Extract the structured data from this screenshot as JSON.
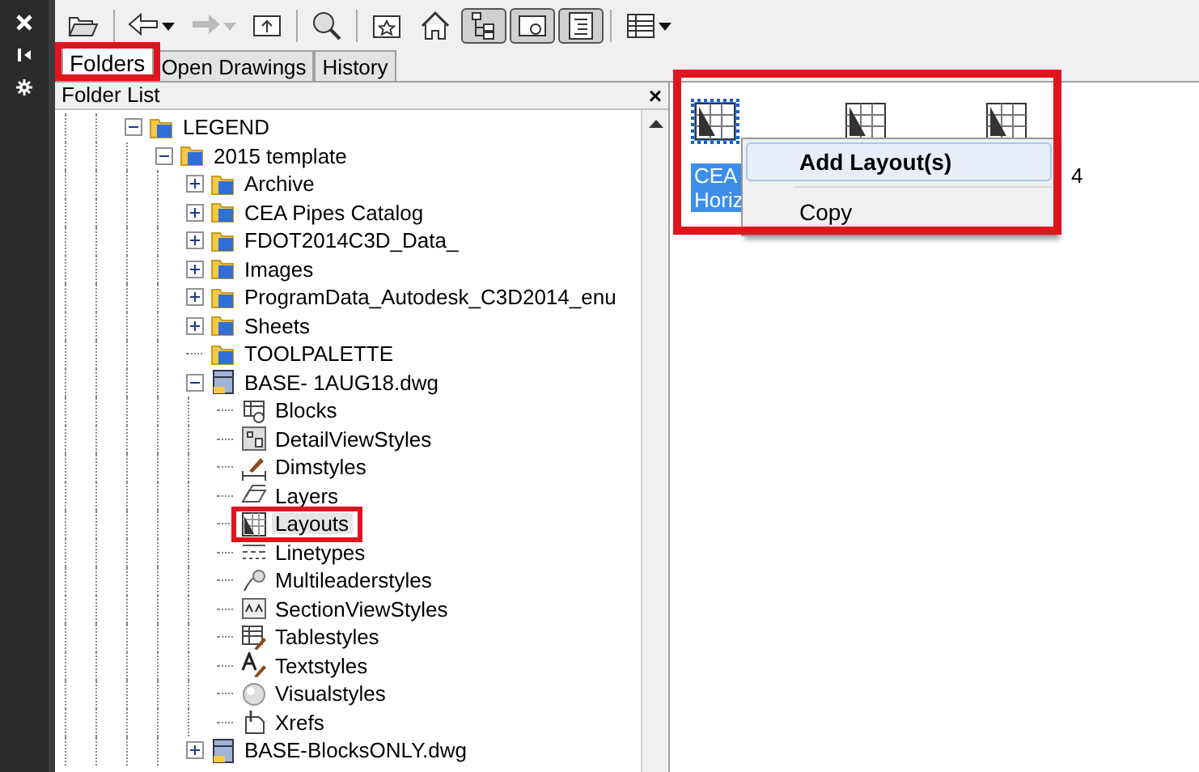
{
  "side_strip": {
    "buttons": [
      {
        "kind": "close"
      },
      {
        "kind": "pin"
      },
      {
        "kind": "settings"
      }
    ]
  },
  "toolbar": [
    {
      "kind": "open",
      "pressed": false,
      "disabled": false
    },
    {
      "kind": "back",
      "pressed": false,
      "disabled": false
    },
    {
      "kind": "forward",
      "pressed": false,
      "disabled": true
    },
    {
      "kind": "up",
      "pressed": false,
      "disabled": false
    },
    {
      "kind": "search",
      "pressed": false,
      "disabled": false
    },
    {
      "kind": "favorites",
      "pressed": false,
      "disabled": false
    },
    {
      "kind": "home",
      "pressed": false,
      "disabled": false
    },
    {
      "kind": "tree",
      "pressed": true,
      "disabled": false
    },
    {
      "kind": "preview",
      "pressed": true,
      "disabled": false
    },
    {
      "kind": "description",
      "pressed": true,
      "disabled": false
    },
    {
      "kind": "views",
      "pressed": false,
      "disabled": false
    }
  ],
  "tabs": [
    {
      "label": "Folders",
      "selected": true,
      "highlight_frame": true
    },
    {
      "label": "Open Drawings",
      "selected": false
    },
    {
      "label": "History",
      "selected": false
    }
  ],
  "folder_list": {
    "title": "Folder List",
    "close": "×",
    "tree": [
      {
        "label": "LEGEND",
        "kind": "folder",
        "expanded": true,
        "selected": false,
        "children": [
          {
            "label": "2015 template",
            "kind": "folder",
            "expanded": true,
            "selected": false,
            "children": [
              {
                "label": "Archive",
                "kind": "folder",
                "expanded": false,
                "selected": false
              },
              {
                "label": "CEA Pipes Catalog",
                "kind": "folder",
                "expanded": false,
                "selected": false
              },
              {
                "label": "FDOT2014C3D_Data_",
                "kind": "folder",
                "expanded": false,
                "selected": false
              },
              {
                "label": "Images",
                "kind": "folder",
                "expanded": false,
                "selected": false
              },
              {
                "label": "ProgramData_Autodesk_C3D2014_enu",
                "kind": "folder",
                "expanded": false,
                "selected": false
              },
              {
                "label": "Sheets",
                "kind": "folder",
                "expanded": false,
                "selected": false
              },
              {
                "label": "TOOLPALETTE",
                "kind": "folder",
                "selected": false
              },
              {
                "label": "BASE- 1AUG18.dwg",
                "kind": "dwg",
                "expanded": true,
                "selected": false,
                "children": [
                  {
                    "label": "Blocks",
                    "kind": "blocks",
                    "selected": false
                  },
                  {
                    "label": "DetailViewStyles",
                    "kind": "detail",
                    "selected": false
                  },
                  {
                    "label": "Dimstyles",
                    "kind": "dim",
                    "selected": false
                  },
                  {
                    "label": "Layers",
                    "kind": "layers",
                    "selected": false
                  },
                  {
                    "label": "Layouts",
                    "kind": "layouts",
                    "selected": true,
                    "highlight_frame": true
                  },
                  {
                    "label": "Linetypes",
                    "kind": "linetypes",
                    "selected": false
                  },
                  {
                    "label": "Multileaderstyles",
                    "kind": "leader",
                    "selected": false
                  },
                  {
                    "label": "SectionViewStyles",
                    "kind": "section",
                    "selected": false
                  },
                  {
                    "label": "Tablestyles",
                    "kind": "table",
                    "selected": false
                  },
                  {
                    "label": "Textstyles",
                    "kind": "text",
                    "selected": false
                  },
                  {
                    "label": "Visualstyles",
                    "kind": "visual",
                    "selected": false
                  },
                  {
                    "label": "Xrefs",
                    "kind": "xref",
                    "selected": false
                  }
                ]
              },
              {
                "label": "BASE-BlocksONLY.dwg",
                "kind": "dwg",
                "expanded": false,
                "selected": false
              }
            ]
          }
        ]
      }
    ]
  },
  "content": {
    "highlight_frame": true,
    "items": [
      {
        "label": "CEA\nHoriz",
        "selected": true
      },
      {
        "selected": false
      },
      {
        "label": "4",
        "selected": false
      }
    ],
    "context_menu": [
      {
        "label": "Add Layout(s)",
        "default": true,
        "highlighted": true
      },
      {
        "label": "Copy",
        "default": false,
        "highlighted": false
      }
    ]
  }
}
